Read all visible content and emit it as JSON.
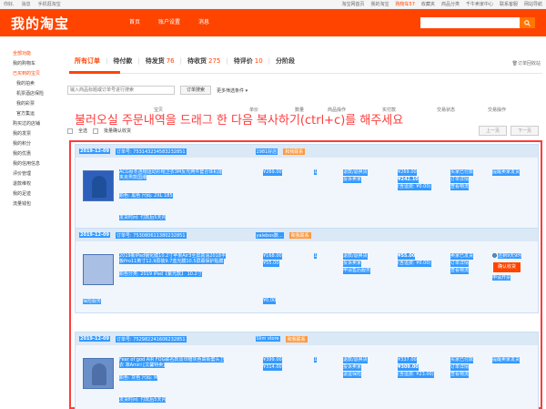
{
  "topbar": {
    "left": [
      "你好,",
      "消息",
      "手机逛淘宝"
    ],
    "right": [
      "淘宝网首页",
      "我的淘宝",
      "购物车57",
      "收藏夹",
      "商品分类",
      "千牛卖家中心",
      "联系客服",
      "网站导航"
    ]
  },
  "header": {
    "logo": "我的淘宝",
    "nav": [
      "首页",
      "账户设置",
      "消息"
    ],
    "search_placeholder": ""
  },
  "sidebar": [
    {
      "label": "全部功能",
      "type": "h"
    },
    {
      "label": "我的购物车",
      "type": "n"
    },
    {
      "label": "已买到的宝贝",
      "type": "h"
    },
    {
      "label": "我的拍卖",
      "type": "sub"
    },
    {
      "label": "机票酒店保险",
      "type": "sub"
    },
    {
      "label": "我的彩票",
      "type": "sub"
    },
    {
      "label": "官方集运",
      "type": "sub"
    },
    {
      "label": "购买过的店铺",
      "type": "n"
    },
    {
      "label": "我的发票",
      "type": "n"
    },
    {
      "label": "我的积分",
      "type": "n"
    },
    {
      "label": "我的优惠",
      "type": "n"
    },
    {
      "label": "我的信用信息",
      "type": "n"
    },
    {
      "label": "评价管理",
      "type": "n"
    },
    {
      "label": "退款维权",
      "type": "n"
    },
    {
      "label": "我的足迹",
      "type": "n"
    },
    {
      "label": "流量钱包",
      "type": "n"
    }
  ],
  "tabs": [
    {
      "label": "所有订单",
      "count": ""
    },
    {
      "label": "待付款",
      "count": ""
    },
    {
      "label": "待发货",
      "count": "76"
    },
    {
      "label": "待收货",
      "count": "275"
    },
    {
      "label": "待评价",
      "count": "10"
    },
    {
      "label": "分阶段",
      "count": ""
    }
  ],
  "recycle_label": "订单回收站",
  "filter": {
    "placeholder": "输入商品标题或订单号进行搜索",
    "search_btn": "订单搜索",
    "more": "更多筛选条件"
  },
  "columns": [
    "宝贝",
    "单价",
    "数量",
    "商品操作",
    "实付款",
    "交易状态",
    "交易操作"
  ],
  "instruction": "불러오실 주문내역을 드래그 한 다음 복사하기(ctrl+c)를 해주세요",
  "select_all": {
    "label": "全选",
    "batch": "批量确认收货"
  },
  "pager": {
    "prev": "上一页",
    "next": "下一页"
  },
  "orders": [
    {
      "date": "2019-12-09",
      "order_no": "订单号: 753143234583232851",
      "shop": "1981好店",
      "badge": "和我联系",
      "title": "ACG秋冬连帽运动衫帽卫衣3M反光两件套合体机能夹克男款国潮",
      "meta1": "颜色: 黑色 尺码: 2XL 185",
      "price": "¥269.00",
      "qty": "1",
      "ops": [
        "退款/退换货",
        "投诉卖家"
      ],
      "paid": [
        "¥269.00",
        "¥242.10",
        "(含运费: ¥0.00)"
      ],
      "status": [
        "买家已付款",
        "订单详情",
        "查看物流"
      ],
      "actions": [
        "提醒卖家发货"
      ],
      "foot": "",
      "deadline": "发货时间: 付款后5天内"
    },
    {
      "date": "2019-12-09",
      "order_no": "订单号: 753080611380232851",
      "shop": "yalebos数...",
      "badge": "和我联系",
      "title": "2019新iPad钢化膜10.2寸苹果Air3全屏高清2018平板Pro11英寸12.9原装9.7蓝光膜10.5屏幕保护贴膜",
      "meta1": "颜色分类: 2019 iPad【紫光款】 10.2寸",
      "price": "¥168.00",
      "price2": "¥55.00",
      "qty": "1",
      "ops": [
        "退款/退换货",
        "投诉卖家",
        "申请售后服务"
      ],
      "paid": [
        "¥55.00",
        "(含运费: ¥0.00)"
      ],
      "status": [
        "卖家已发货",
        "订单详情",
        "查看物流"
      ],
      "actions": [
        "还剩9天9时",
        "确认收货",
        "申请开票"
      ],
      "foot": "¥0.00",
      "deadline": "保险服务"
    },
    {
      "date": "2019-12-09",
      "order_no": "订单号: 752982241606232851",
      "shop": "Slim store",
      "badge": "和我联系",
      "title": "Fear of god AIR FOG联名款烫印暗灰色高街套头卫衣 准Amiri [文馨特卖]",
      "meta1": "颜色: 灰色 尺码: M",
      "price": "¥399.00",
      "price2": "¥314.00",
      "qty": "1",
      "ops": [
        "退款/退换货",
        "投诉卖家",
        "退运保险"
      ],
      "paid": [
        "¥337.00",
        "¥309.00",
        "(含运费: ¥23.00)"
      ],
      "status": [
        "买家已付款",
        "订单详情",
        "查看物流"
      ],
      "actions": [
        "提醒卖家发货"
      ],
      "foot": "",
      "deadline": "发货时间: 付款后5天内"
    }
  ],
  "colors": {
    "accent": "#ff4400",
    "selection": "#3399ff",
    "outline": "#ff3b3b"
  }
}
